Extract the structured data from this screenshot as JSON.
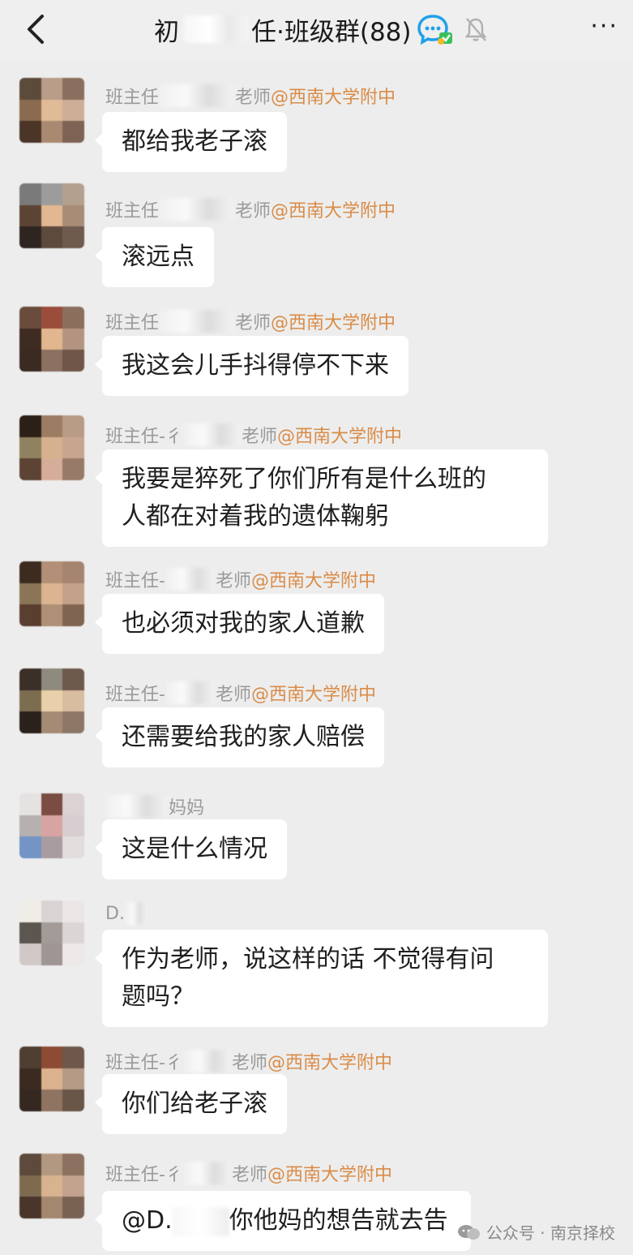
{
  "header": {
    "title_left": "初",
    "title_right": "任·班级群(88)",
    "more_label": "···"
  },
  "colors": {
    "school": "#d98c48",
    "bubble": "#ffffff",
    "background": "#ededed"
  },
  "messages": [
    {
      "sender": {
        "prefix": "班主任",
        "suffix": "老师",
        "school": "@西南大学附中"
      },
      "text": "都给我老子滚"
    },
    {
      "sender": {
        "prefix": "班主任",
        "suffix": "老师",
        "school": "@西南大学附中"
      },
      "text": "滚远点"
    },
    {
      "sender": {
        "prefix": "班主任",
        "suffix": "老师",
        "school": "@西南大学附中"
      },
      "text": "我这会儿手抖得停不下来"
    },
    {
      "sender": {
        "prefix": "班主任-彳",
        "suffix": "老师",
        "school": "@西南大学附中"
      },
      "line1": "我要是猝死了你们所有是什么班的",
      "line2": "人都在对着我的遗体鞠躬"
    },
    {
      "sender": {
        "prefix": "班主任-",
        "suffix": "老师",
        "school": "@西南大学附中"
      },
      "text": "也必须对我的家人道歉"
    },
    {
      "sender": {
        "prefix": "班主任-",
        "suffix": "老师",
        "school": "@西南大学附中"
      },
      "text": "还需要给我的家人赔偿"
    },
    {
      "sender": {
        "prefix": "",
        "suffix": "妈妈",
        "school": ""
      },
      "text": "这是什么情况"
    },
    {
      "sender": {
        "prefix": "D.",
        "suffix": "",
        "school": ""
      },
      "line1": "作为老师，说这样的话 不觉得有问",
      "line2": "题吗？"
    },
    {
      "sender": {
        "prefix": "班主任-彳",
        "suffix": "老师",
        "school": "@西南大学附中"
      },
      "text": "你们给老子滚"
    },
    {
      "sender": {
        "prefix": "班主任-彳",
        "suffix": "老师",
        "school": "@西南大学附中"
      },
      "mention": "@D.",
      "text": "你他妈的想告就去告"
    }
  ],
  "watermark": {
    "label": "公众号 · 南京择校"
  }
}
